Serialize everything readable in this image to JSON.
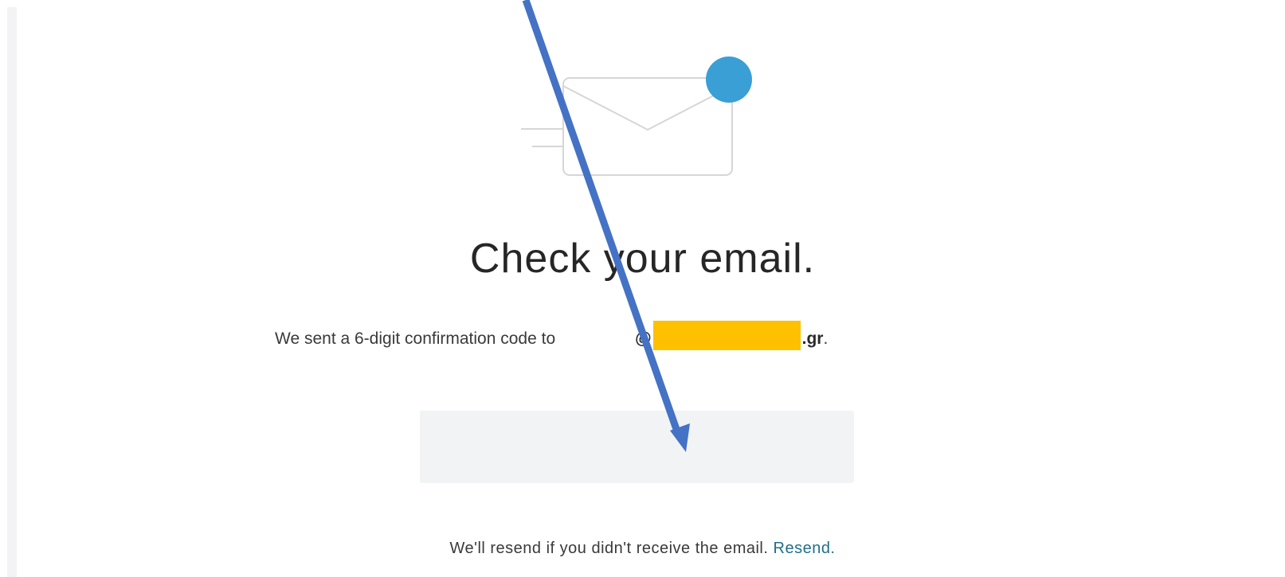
{
  "page": {
    "heading": "Check your email.",
    "subtext_prefix": "We sent a 6-digit confirmation code to",
    "email_at": "@",
    "email_domain_suffix": ".gr",
    "subtext_period": ".",
    "code_input": {
      "value": "",
      "placeholder": ""
    },
    "footer_text": "We'll resend if you didn't receive the email.",
    "resend_label": "Resend."
  },
  "colors": {
    "heading": "#262626",
    "notification_dot": "#3a9fd4",
    "redaction": "#ffc000",
    "arrow": "#4472c4",
    "resend_link": "#1f6f8b",
    "input_background": "#f2f3f5"
  },
  "icons": {
    "envelope": "envelope-icon",
    "notification_dot": "notification-dot-icon",
    "annotation_arrow": "annotation-arrow"
  }
}
